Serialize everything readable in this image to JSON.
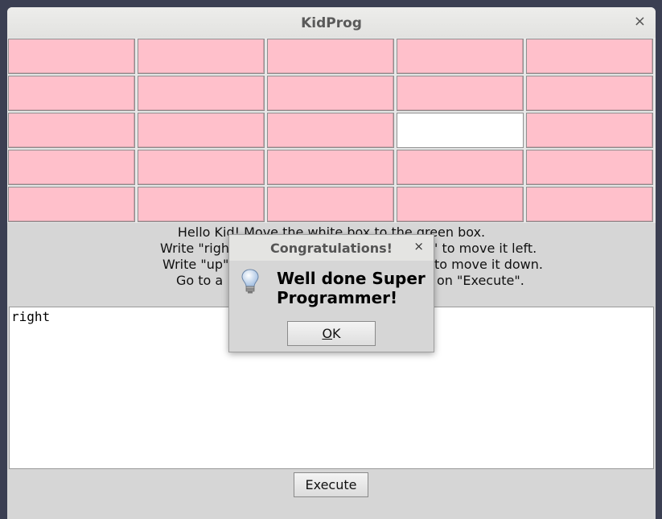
{
  "window": {
    "title": "KidProg",
    "close_label": "×"
  },
  "grid": {
    "rows": 5,
    "cols": 5,
    "cell_color": "#ffc0cb",
    "white_cell": {
      "row": 2,
      "col": 3
    }
  },
  "instructions": [
    "Hello Kid! Move the white box to the green box.",
    "Write \"righ",
    "\" to move it left.",
    "Write \"up\"",
    "to move it down.",
    "Go to a",
    "on \"Execute\"."
  ],
  "editor": {
    "value": "right"
  },
  "execute_button": {
    "label": "Execute"
  },
  "dialog": {
    "title": "Congratulations!",
    "close_label": "×",
    "message": "Well done Super Programmer!",
    "ok_mnemonic": "O",
    "ok_rest": "K",
    "icon": "lightbulb-icon"
  }
}
